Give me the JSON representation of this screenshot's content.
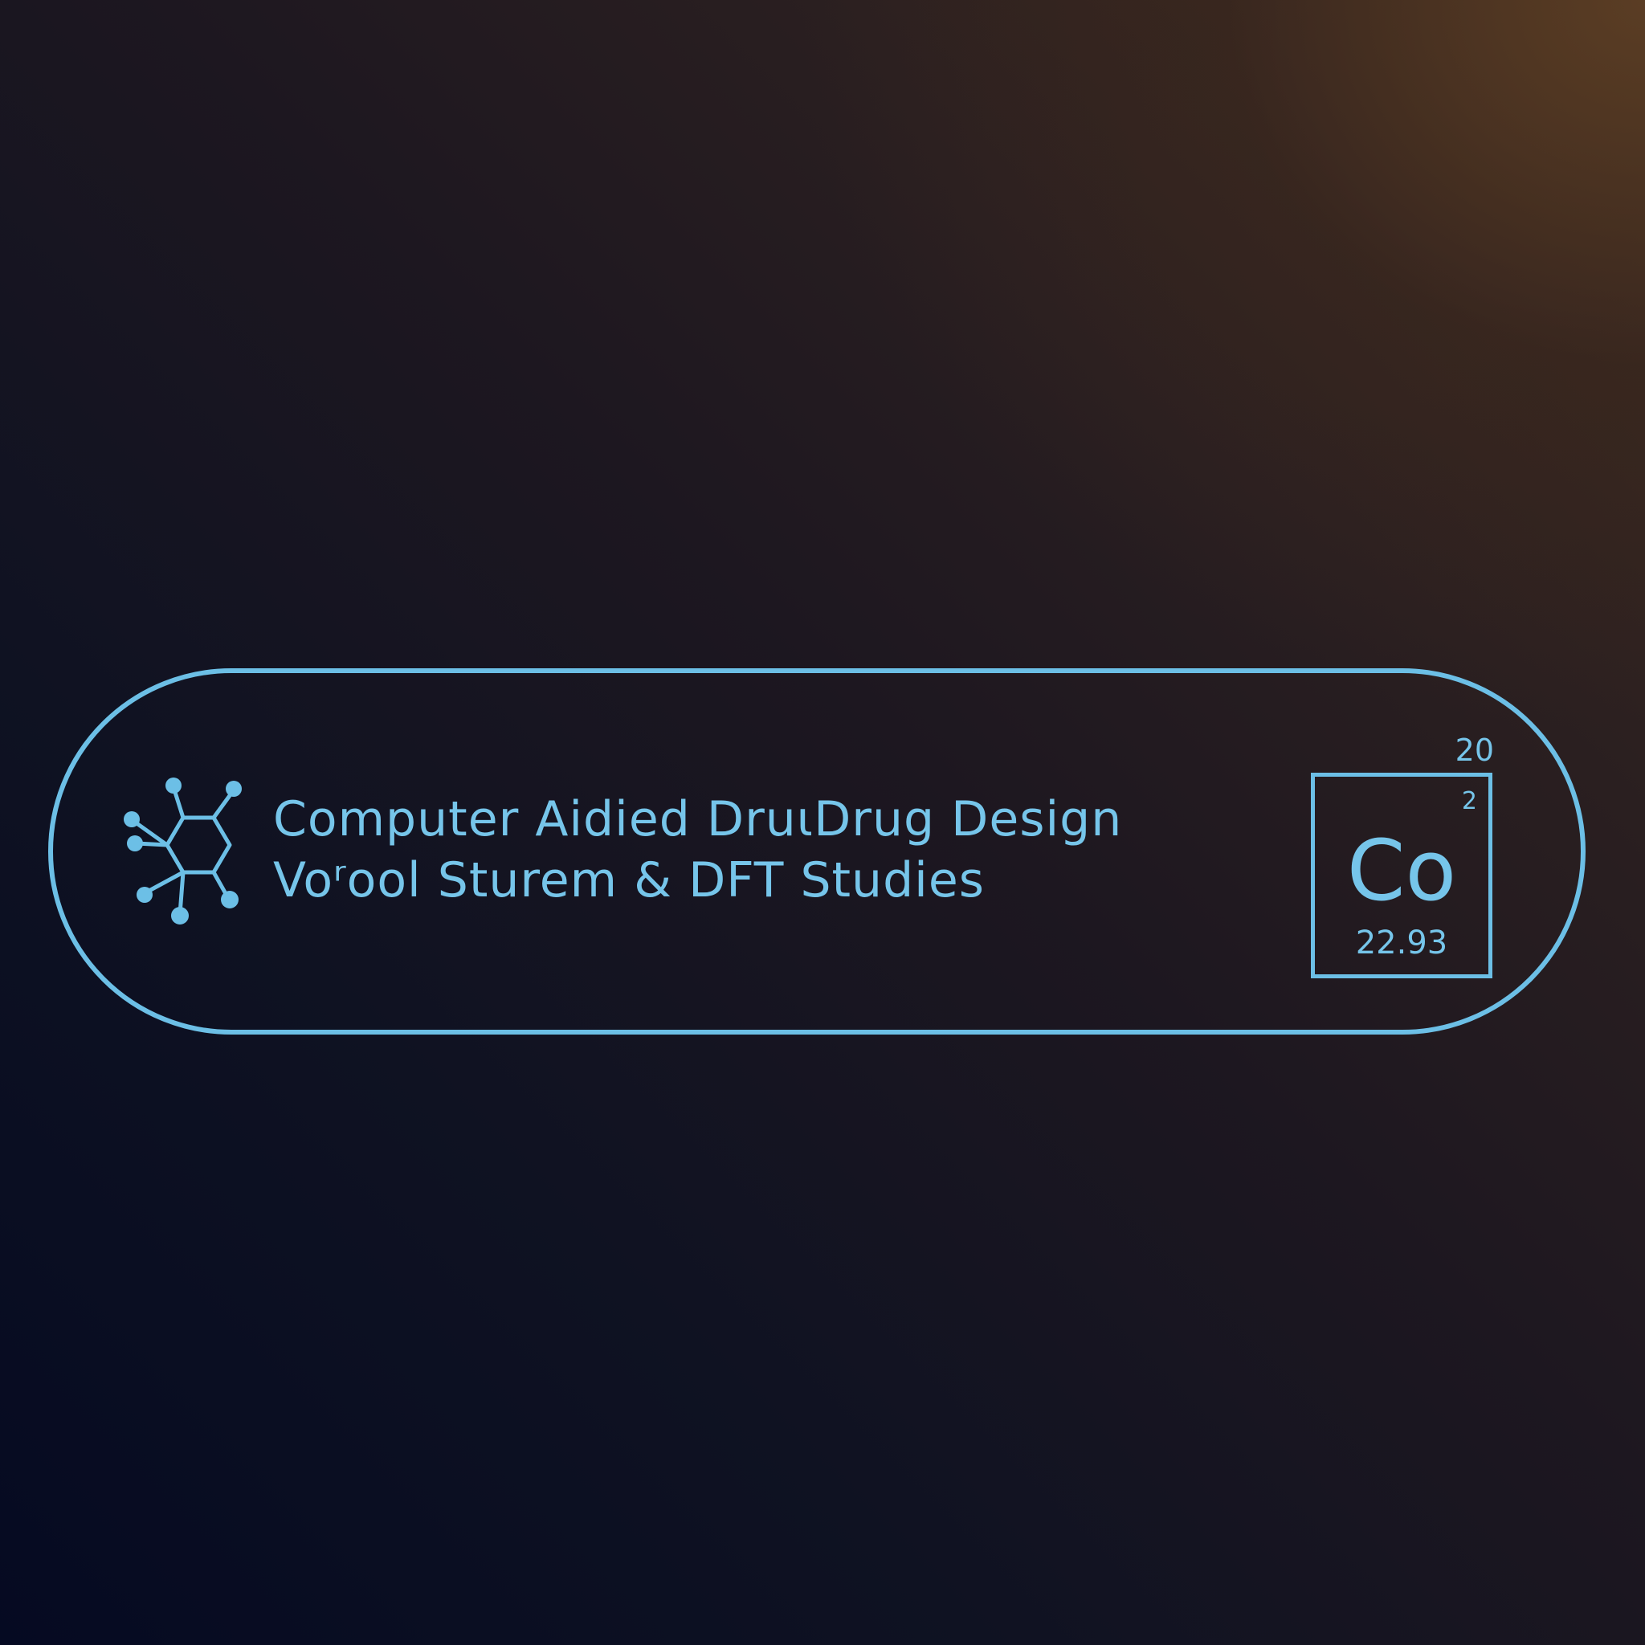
{
  "banner": {
    "title_line1": "Computer Aidied DruιDrug Design",
    "title_line2": "Voʳool Sturem & DFT Studies",
    "accent_color": "#6cbfe6",
    "icon": "molecule-icon"
  },
  "element_tile": {
    "number": "20",
    "charge": "2",
    "symbol": "Co",
    "mass": "22.93"
  }
}
